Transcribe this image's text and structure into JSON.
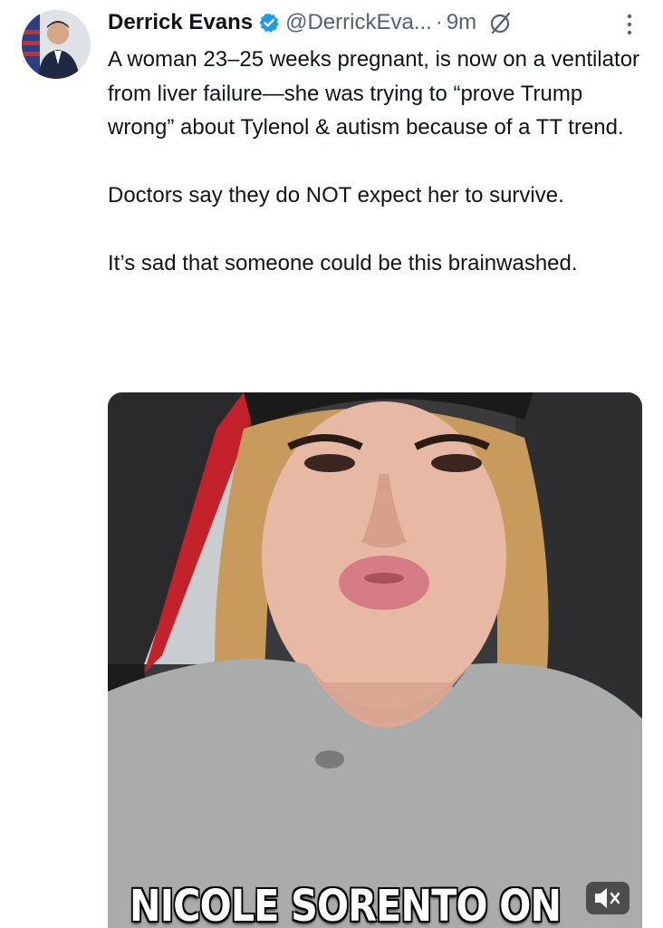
{
  "tweet": {
    "author": {
      "display_name": "Derrick Evans",
      "handle": "@DerrickEva...",
      "avatar_icon": "profile-photo"
    },
    "separator": "·",
    "time": "9m",
    "icons": {
      "verified": "verified-badge-icon",
      "grok": "grok-icon",
      "more": "more-vertical-icon"
    },
    "colors": {
      "verified": "#1d9bf0",
      "secondary_text": "#536471",
      "primary_text": "#0f1419"
    },
    "paragraphs": [
      "A woman 23–25 weeks pregnant, is now on a ventilator from liver failure—she was trying to “prove Trump wrong” about Tylenol & autism because of a TT trend.",
      "Doctors say they do NOT expect her to survive.",
      "It’s sad that someone could be this brainwashed."
    ],
    "media": {
      "caption": "NICOLE SORENTO ON",
      "mute_icon": "speaker-muted-icon"
    }
  }
}
